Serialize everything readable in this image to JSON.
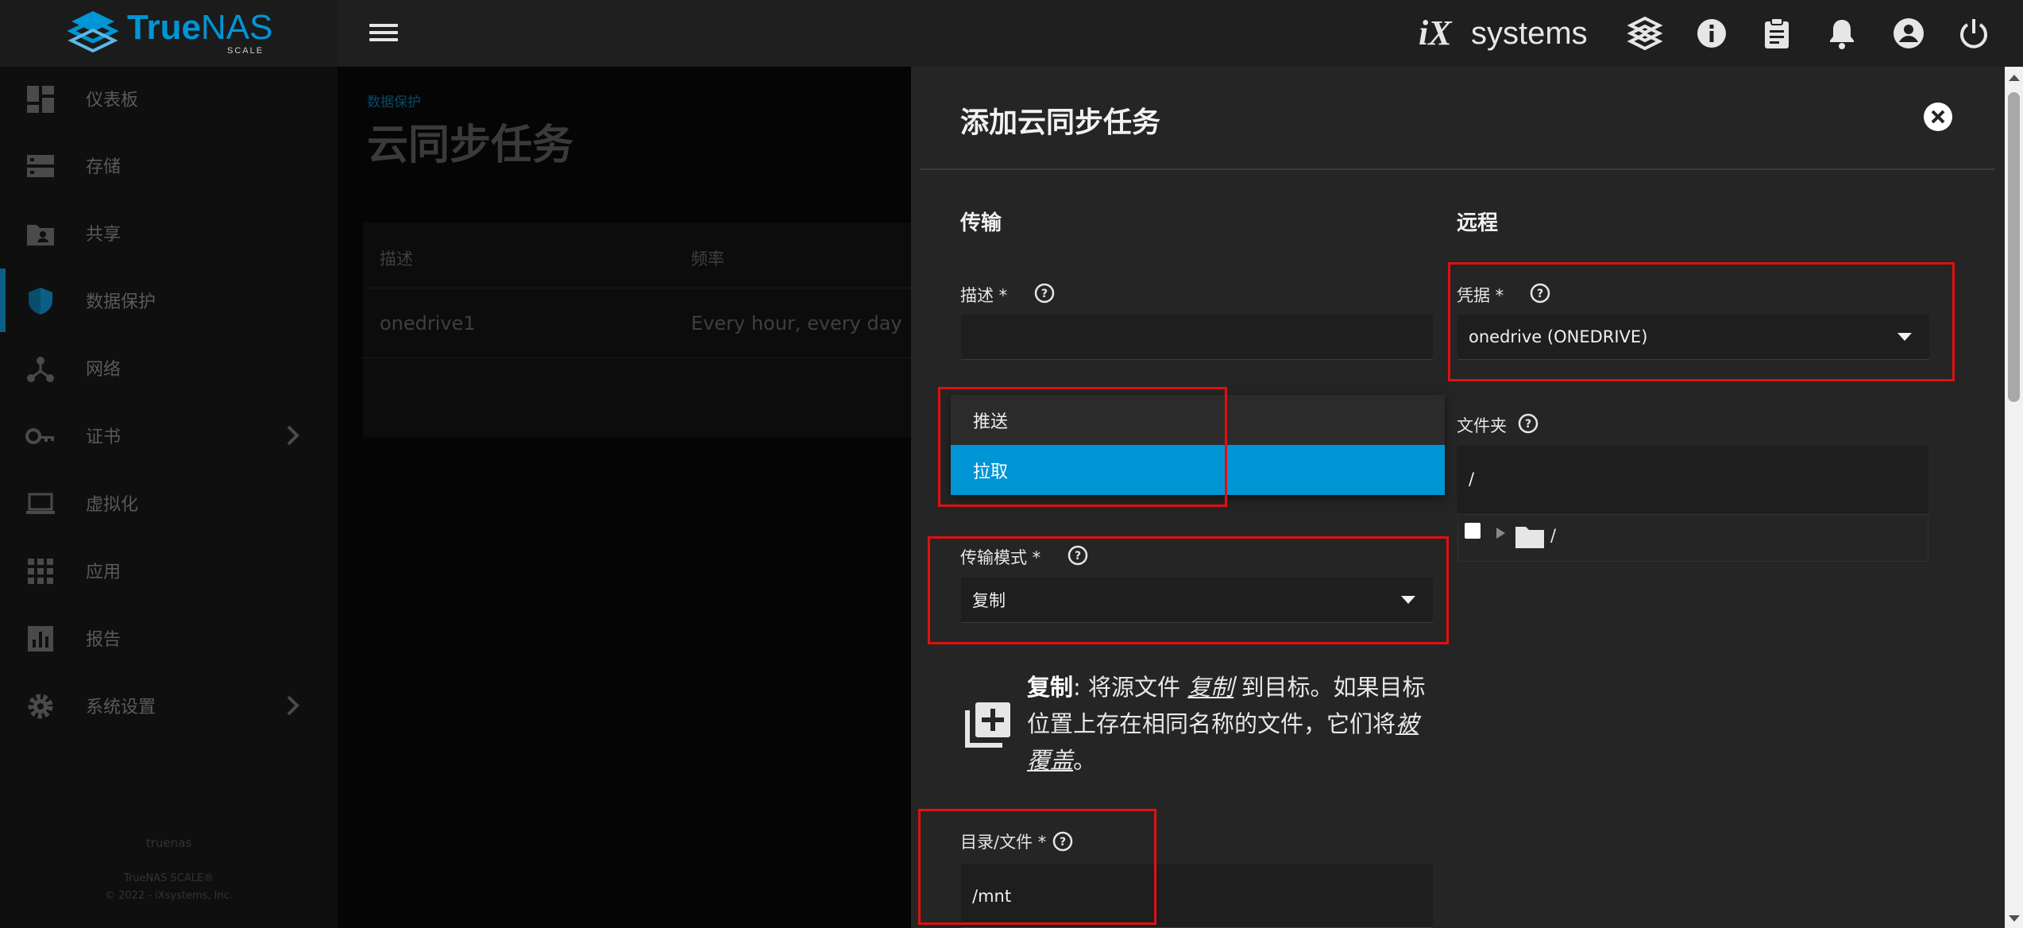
{
  "brand": {
    "name_bold": "True",
    "name_rest": "NAS",
    "edition": "SCALE"
  },
  "vendor": {
    "ix": "iX",
    "systems": "systems"
  },
  "topbar_icons": [
    "truecommand-icon",
    "info-icon",
    "clipboard-icon",
    "bell-icon",
    "account-icon",
    "power-icon"
  ],
  "sidebar": {
    "items": [
      {
        "label": "仪表板",
        "icon": "dashboard-icon"
      },
      {
        "label": "存储",
        "icon": "storage-icon"
      },
      {
        "label": "共享",
        "icon": "folder-share-icon"
      },
      {
        "label": "数据保护",
        "icon": "shield-icon",
        "active": true
      },
      {
        "label": "网络",
        "icon": "network-icon"
      },
      {
        "label": "证书",
        "icon": "key-icon",
        "has_children": true
      },
      {
        "label": "虚拟化",
        "icon": "laptop-icon"
      },
      {
        "label": "应用",
        "icon": "apps-grid-icon"
      },
      {
        "label": "报告",
        "icon": "report-chart-icon"
      },
      {
        "label": "系统设置",
        "icon": "gear-icon",
        "has_children": true
      }
    ],
    "footer": {
      "hostname": "truenas",
      "product": "TrueNAS SCALE®",
      "copyright": "© 2022 - iXsystems, Inc."
    }
  },
  "main": {
    "breadcrumb": "数据保护",
    "title": "云同步任务",
    "table": {
      "headers": [
        "描述",
        "频率"
      ],
      "rows": [
        {
          "desc": "onedrive1",
          "freq": "Every hour, every day"
        }
      ]
    }
  },
  "panel": {
    "title": "添加云同步任务",
    "transfer": {
      "heading": "传输",
      "desc_label": "描述 *",
      "desc_value": "",
      "direction_options": [
        "推送",
        "拉取"
      ],
      "direction_selected": "拉取",
      "mode_label": "传输模式 *",
      "mode_value": "复制",
      "hint": {
        "bold": "复制",
        "t1": ": 将源文件 ",
        "i1": "复制",
        "t2": " 到目标。如果目标位置上存在相同名称的文件，它们将",
        "i2": "被覆盖",
        "t3": "。"
      },
      "path_label": "目录/文件 *",
      "path_value": "/mnt"
    },
    "remote": {
      "heading": "远程",
      "cred_label": "凭据 *",
      "cred_value": "onedrive (ONEDRIVE)",
      "folder_label": "文件夹",
      "folder_value": "/",
      "tree_root": "/"
    }
  },
  "colors": {
    "accent": "#0095d5",
    "annotation": "#e01010"
  }
}
